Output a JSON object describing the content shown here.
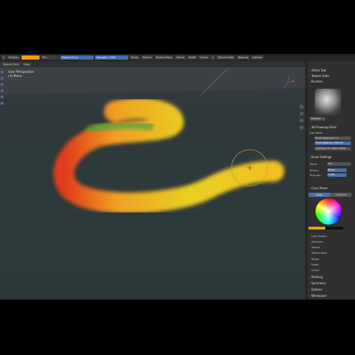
{
  "header": {
    "mode": "Texture Paint",
    "brush_name": "TexDraw",
    "blend": "Mix",
    "radius_label": "Radius",
    "radius_value": "80 px",
    "strength_label": "Strength",
    "strength_value": "1.000",
    "brush_menu": "Brush",
    "texture_menu": "Texture",
    "texture_mask_menu": "Texture Mask",
    "stroke_menu": "Stroke",
    "falloff_menu": "Falloff",
    "cursor_menu": "Cursor",
    "texture_slots_menu": "Texture Slots",
    "masking_menu": "Masking",
    "options_menu": "Options"
  },
  "toolbar2": {
    "mode": "Texture Paint",
    "view": "View"
  },
  "viewport": {
    "info_line1": "User Perspective",
    "info_line2": "(1) Plane"
  },
  "panel": {
    "active_tool": "Active Tool",
    "texture_slots": "Texture Slots",
    "brushes": "Brushes",
    "brush_name": "TexDraw",
    "flowmap_header": "3D Flowmap Paint",
    "exit_mode": "Exit Mode",
    "brush_spacing_label": "Brush spacing",
    "brush_spacing_value": "0.10",
    "trace_distance_label": "Trace distance",
    "trace_distance_value": "1000.00",
    "flowmap_object_mode": "Flowmap 3D Object Mode",
    "brush_settings": "Brush Settings",
    "blend_label": "Blend",
    "blend_value": "Mix",
    "radius_label": "Radius",
    "radius_value": "80 px",
    "strength_label": "Strength",
    "strength_value": "1.000",
    "color_picker": "Color Picker",
    "tab_color": "Color",
    "tab_gradient": "Gradient",
    "color_palette": "Color Palette",
    "advanced": "Advanced",
    "texture": "Texture",
    "texture_mask": "Texture Mask",
    "stroke": "Stroke",
    "falloff": "Falloff",
    "cursor": "Cursor",
    "masking": "Masking",
    "symmetry": "Symmetry",
    "options": "Options",
    "workspace": "Workspace"
  },
  "colors": {
    "accent": "#f29c13",
    "selection": "#4772b3",
    "background": "#3a3d42"
  }
}
